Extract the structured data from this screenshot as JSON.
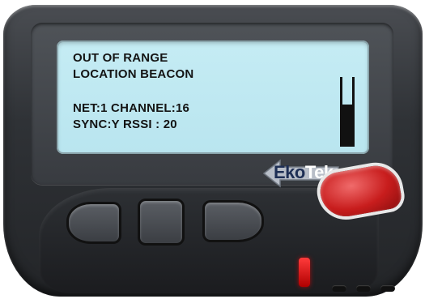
{
  "device": {
    "brand_left": "Eko",
    "brand_right": "Tek",
    "accent_red": "#c81d1d",
    "screen_color": "#c5ecf4"
  },
  "lcd": {
    "line1": "OUT OF RANGE",
    "line2": "LOCATION BEACON",
    "line3": "NET:1  CHANNEL:16",
    "line4": "SYNC:Y  RSSI : 20",
    "signal_level_fraction": 0.6
  }
}
